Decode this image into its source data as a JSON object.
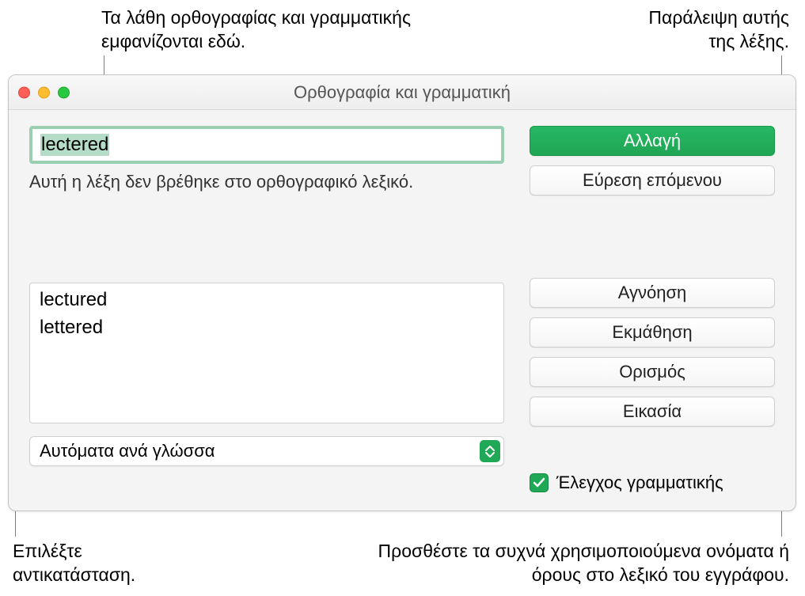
{
  "annotations": {
    "top_left": "Τα λάθη ορθογραφίας και γραμματικής εμφανίζονται εδώ.",
    "top_right": "Παράλειψη αυτής της λέξης.",
    "bottom_left": "Επιλέξτε αντικατάσταση.",
    "bottom_right": "Προσθέστε τα συχνά χρησιμοποιούμενα ονόματα ή όρους στο λεξικό του εγγράφου."
  },
  "window": {
    "title": "Ορθογραφία και γραμματική",
    "error_word": "lectered",
    "hint": "Αυτή η λέξη δεν βρέθηκε στο ορθογραφικό λεξικό.",
    "suggestions": [
      "lectured",
      "lettered"
    ],
    "language_selector": "Αυτόματα ανά γλώσσα"
  },
  "buttons": {
    "change": "Αλλαγή",
    "find_next": "Εύρεση επόμενου",
    "ignore": "Αγνόηση",
    "learn": "Εκμάθηση",
    "define": "Ορισμός",
    "guess": "Εικασία"
  },
  "checkbox": {
    "grammar_check": "Έλεγχος γραμματικής"
  }
}
